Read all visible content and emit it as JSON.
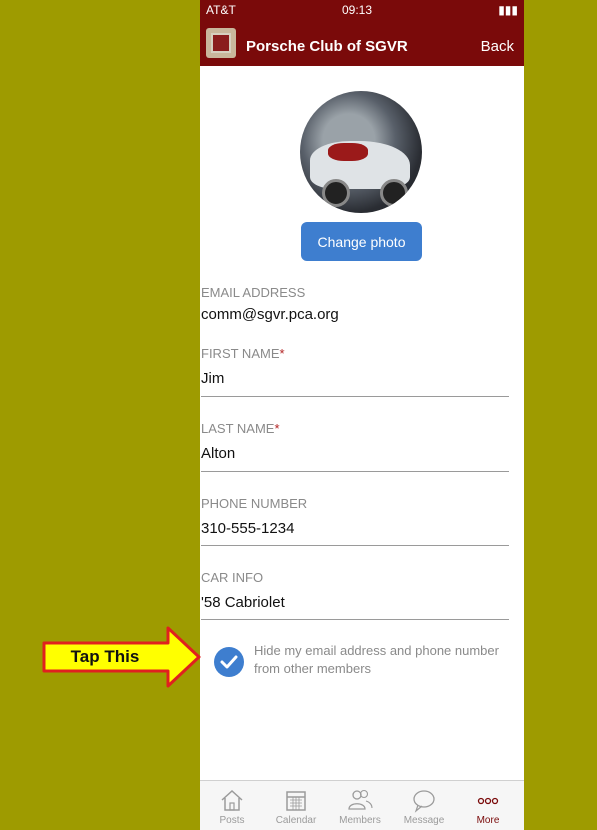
{
  "status_bar": {
    "carrier": "AT&T",
    "time": "09:13"
  },
  "navbar": {
    "title": "Porsche Club of SGVR",
    "back_label": "Back"
  },
  "profile": {
    "change_photo_label": "Change photo",
    "email_label": "EMAIL ADDRESS",
    "email_value": "comm@sgvr.pca.org",
    "first_name_label": "FIRST NAME",
    "first_name_value": "Jim",
    "last_name_label": "LAST NAME",
    "last_name_value": "Alton",
    "phone_label": "PHONE NUMBER",
    "phone_value": "310-555-1234",
    "car_label": "CAR INFO",
    "car_value": "'58 Cabriolet",
    "required_mark": "*",
    "hide_contact_text": "Hide my email address and phone number from other members",
    "hide_contact_checked": true
  },
  "annotation": {
    "tap_label": "Tap This",
    "arrow_color": "#ffff00",
    "arrow_border": "#e0201f"
  },
  "tabs": [
    {
      "label": "Posts",
      "icon": "home-icon"
    },
    {
      "label": "Calendar",
      "icon": "calendar-icon"
    },
    {
      "label": "Members",
      "icon": "members-icon"
    },
    {
      "label": "Message",
      "icon": "message-icon"
    },
    {
      "label": "More",
      "icon": "more-icon",
      "active": true
    }
  ],
  "colors": {
    "nav_red": "#7a0a0a",
    "accent_blue": "#3e7ecf",
    "background_olive": "#9e9b00"
  }
}
